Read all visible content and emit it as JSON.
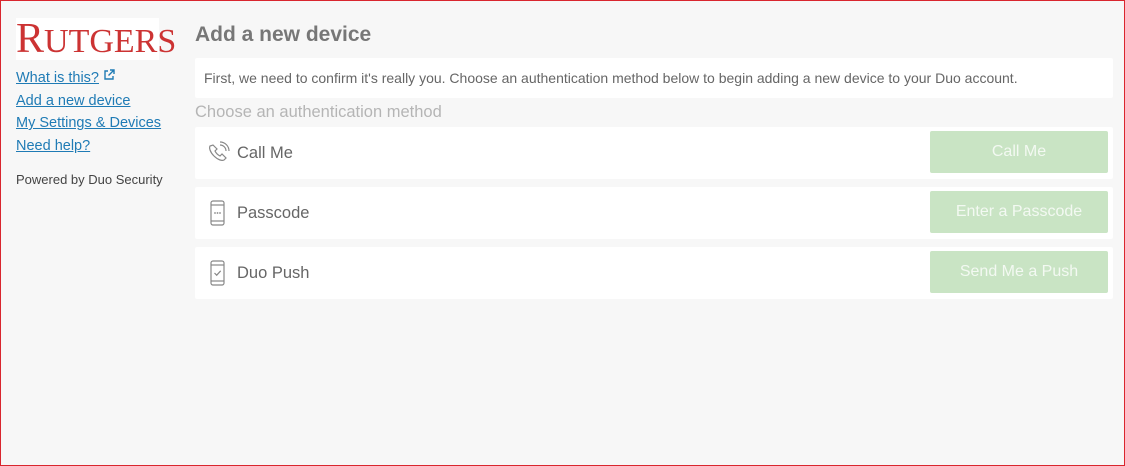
{
  "brand": {
    "logo_cap": "R",
    "logo_rest": "UTGERS"
  },
  "sidebar": {
    "links": [
      {
        "label": "What is this?"
      },
      {
        "label": "Add a new device"
      },
      {
        "label": "My Settings & Devices"
      },
      {
        "label": "Need help?"
      }
    ],
    "powered_by": "Powered by Duo Security"
  },
  "main": {
    "title": "Add a new device",
    "intro": "First, we need to confirm it's really you. Choose an authentication method below to begin adding a new device to your Duo account.",
    "choose_label": "Choose an authentication method",
    "methods": [
      {
        "icon": "phone-call-icon",
        "label": "Call Me",
        "button": "Call Me"
      },
      {
        "icon": "passcode-phone-icon",
        "label": "Passcode",
        "button": "Enter a Passcode"
      },
      {
        "icon": "push-phone-icon",
        "label": "Duo Push",
        "button": "Send Me a Push"
      }
    ]
  },
  "colors": {
    "brand_red": "#cc3333",
    "link_blue": "#1f7bb5",
    "button_green": "#c9e4c4"
  }
}
